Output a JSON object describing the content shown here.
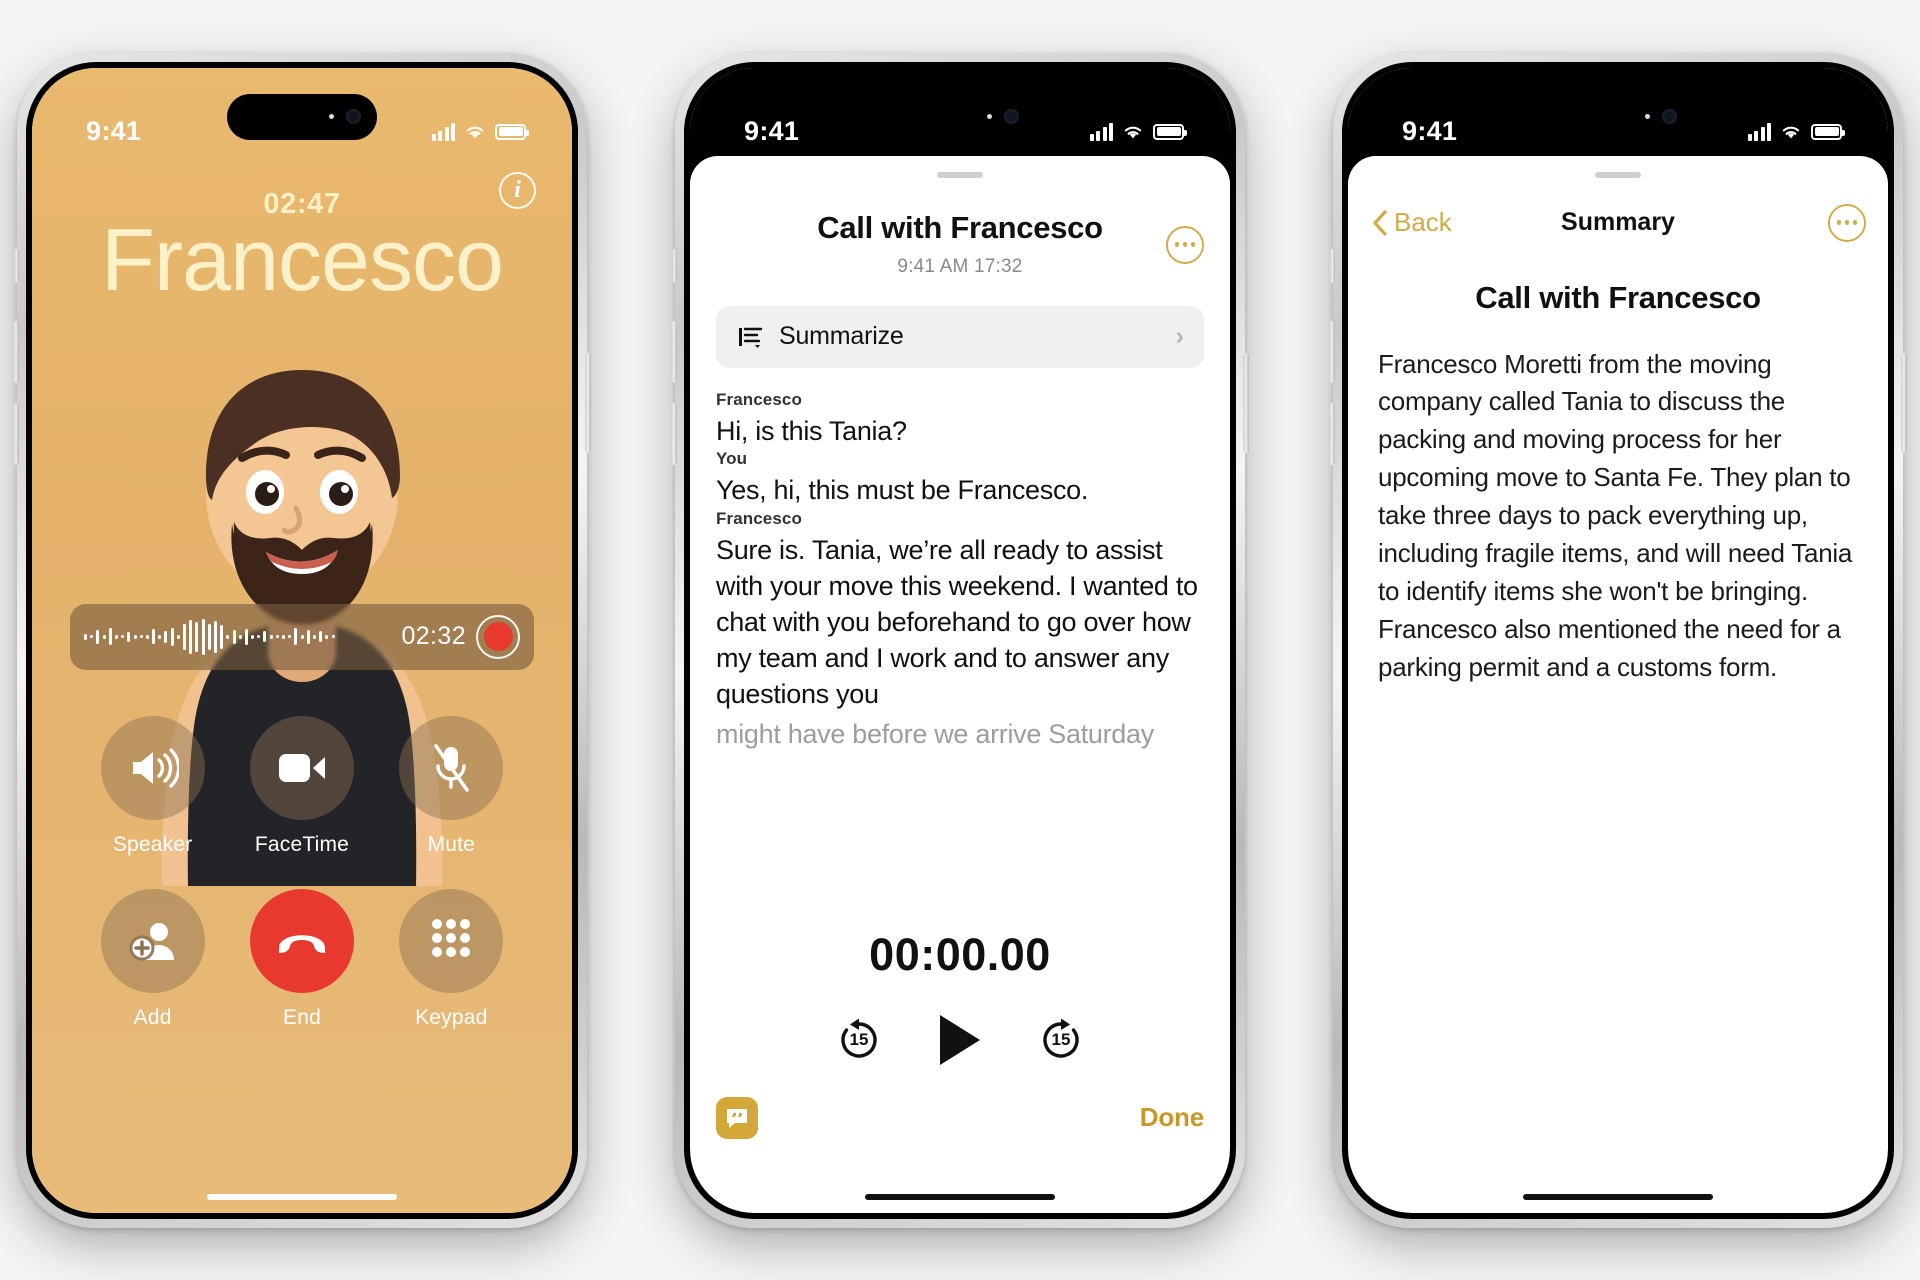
{
  "phone1": {
    "status": {
      "time": "9:41",
      "signal_icon": "cellular-bars-icon",
      "wifi_icon": "wifi-icon",
      "battery_icon": "battery-icon"
    },
    "info_button_glyph": "i",
    "call_timer": "02:47",
    "caller_name": "Francesco",
    "background_color": "#e9b96e",
    "recording": {
      "time": "02:32",
      "record_icon": "record-dot-icon",
      "waveform_icon": "audio-waveform-icon"
    },
    "controls": [
      {
        "label": "Speaker",
        "icon": "speaker-icon"
      },
      {
        "label": "FaceTime",
        "icon": "video-camera-icon"
      },
      {
        "label": "Mute",
        "icon": "microphone-muted-icon"
      },
      {
        "label": "Add",
        "icon": "add-person-icon"
      },
      {
        "label": "End",
        "icon": "end-call-icon"
      },
      {
        "label": "Keypad",
        "icon": "keypad-icon"
      }
    ],
    "end_button_color": "#e8392f"
  },
  "phone2": {
    "status": {
      "time": "9:41",
      "signal_icon": "cellular-bars-icon",
      "wifi_icon": "wifi-icon",
      "battery_icon": "battery-icon"
    },
    "title": "Call with Francesco",
    "subtitle": "9:41 AM  17:32",
    "more_icon": "more-options-icon",
    "summarize": {
      "label": "Summarize",
      "icon": "summarize-lines-icon",
      "chevron": "›"
    },
    "transcript": [
      {
        "speaker": "Francesco",
        "text": "Hi, is this Tania?",
        "faded": false
      },
      {
        "speaker": "You",
        "text": "Yes, hi, this must be Francesco.",
        "faded": false
      },
      {
        "speaker": "Francesco",
        "text": "Sure is. Tania, we’re all ready to assist with your move this weekend. I wanted to chat with you beforehand to go over how my team and I work and to answer any questions you",
        "faded": false
      },
      {
        "speaker": "",
        "text": "might have before we arrive Saturday",
        "faded": true
      }
    ],
    "player": {
      "time": "00:00.00",
      "back_label": "15",
      "forward_label": "15",
      "back_icon": "skip-back-15-icon",
      "play_icon": "play-icon",
      "forward_icon": "skip-forward-15-icon"
    },
    "footer": {
      "live_icon": "live-transcript-icon",
      "done_label": "Done",
      "accent_color": "#c79a27"
    }
  },
  "phone3": {
    "status": {
      "time": "9:41",
      "signal_icon": "cellular-bars-icon",
      "wifi_icon": "wifi-icon",
      "battery_icon": "battery-icon"
    },
    "nav": {
      "back_label": "Back",
      "back_icon": "chevron-left-icon",
      "title": "Summary",
      "more_icon": "more-options-icon",
      "accent_color": "#d3ab45"
    },
    "title": "Call with Francesco",
    "body": "Francesco Moretti from the moving company called Tania to discuss the packing and moving process for her upcoming move to Santa Fe. They plan to take three days to pack everything up, including fragile items, and will need Tania to identify items she won't be bringing. Francesco also mentioned the need for a parking permit and a customs form."
  }
}
